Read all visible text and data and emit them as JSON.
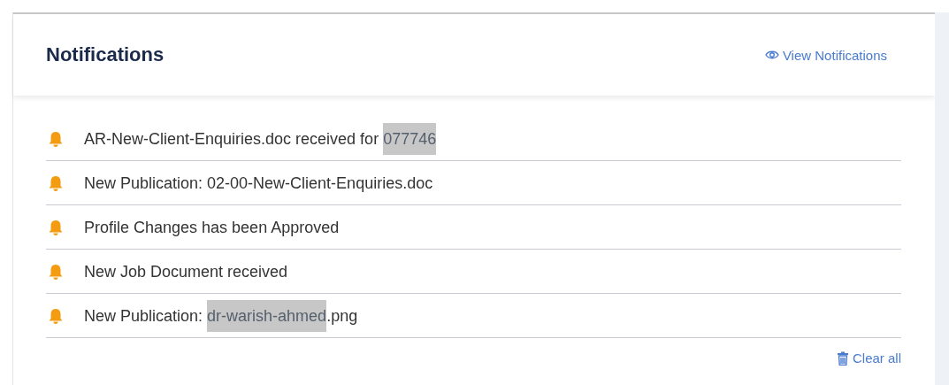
{
  "panel": {
    "title": "Notifications",
    "view_link": "View Notifications"
  },
  "notifications": [
    {
      "parts": [
        {
          "text": "AR-New-Client-Enquiries.doc received for ",
          "highlighted": false
        },
        {
          "text": "077746",
          "highlighted": true
        }
      ]
    },
    {
      "parts": [
        {
          "text": "New Publication: 02-00-New-Client-Enquiries.doc",
          "highlighted": false
        }
      ]
    },
    {
      "parts": [
        {
          "text": "Profile Changes has been Approved",
          "highlighted": false
        }
      ]
    },
    {
      "parts": [
        {
          "text": "New Job Document received",
          "highlighted": false
        }
      ]
    },
    {
      "parts": [
        {
          "text": "New Publication: ",
          "highlighted": false
        },
        {
          "text": "dr-warish-ahmed",
          "highlighted": true
        },
        {
          "text": ".png",
          "highlighted": false
        }
      ]
    }
  ],
  "clear_link": "Clear all"
}
